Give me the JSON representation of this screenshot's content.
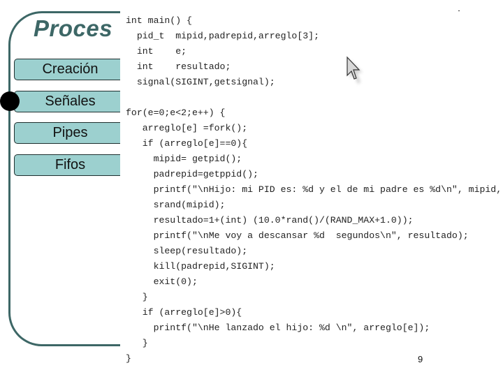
{
  "slide": {
    "title": "Proces",
    "page_number": "9",
    "accent_color": "#3d6766",
    "button_color": "#9cd0cf"
  },
  "nav": {
    "items": [
      {
        "label": "Creación",
        "active": false
      },
      {
        "label": "Señales",
        "active": true
      },
      {
        "label": "Pipes",
        "active": false
      },
      {
        "label": "Fifos",
        "active": false
      }
    ]
  },
  "code": {
    "block1": [
      "int main() {",
      "  pid_t  mipid,padrepid,arreglo[3];",
      "  int    e;",
      "  int    resultado;",
      "  signal(SIGINT,getsignal);"
    ],
    "block2": [
      "for(e=0;e<2;e++) {",
      "   arreglo[e] =fork();",
      "   if (arreglo[e]==0){",
      "     mipid= getpid();",
      "     padrepid=getppid();",
      "     printf(\"\\nHijo: mi PID es: %d y el de mi padre es %d\\n\", mipid, padrepid);",
      "     srand(mipid);",
      "     resultado=1+(int) (10.0*rand()/(RAND_MAX+1.0));",
      "     printf(\"\\nMe voy a descansar %d  segundos\\n\", resultado);",
      "     sleep(resultado);",
      "     kill(padrepid,SIGINT);",
      "     exit(0);",
      "   }",
      "   if (arreglo[e]>0){",
      "     printf(\"\\nHe lanzado el hijo: %d \\n\", arreglo[e]);",
      "   }",
      "}"
    ]
  },
  "icons": {
    "cursor": "mouse-pointer-icon",
    "bullet": "active-bullet-icon"
  }
}
